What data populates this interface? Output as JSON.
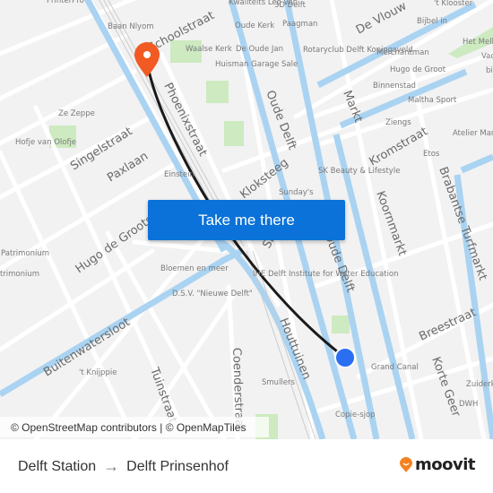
{
  "map": {
    "colors": {
      "background": "#f2f2f2",
      "road": "#ffffff",
      "water": "#aad3f2",
      "park": "#cdeac0",
      "route_line": "#1a1a1a",
      "origin_marker": "#2a6ff2",
      "destination_marker": "#f15a22",
      "cta": "#0a72d8"
    },
    "street_labels": [
      "Schoolstraat",
      "Phoenixstraat",
      "De Vlouw",
      "Oude Delft",
      "Markt",
      "Kromstraat",
      "Koornmarkt",
      "Brabantse Turfmarkt",
      "Singelstraat",
      "Paxlaan",
      "Hugo de Grootstraat",
      "Kloksteeg",
      "Buitenwatersloot",
      "Tuinstraat",
      "Coenderstraat",
      "Houttuinen",
      "Breestraat",
      "Korte Geer",
      "Oude Delft",
      "Sint"
    ],
    "poi_labels": [
      "PrinterPro",
      "Baan Nlyom",
      "Waalse Kerk",
      "De Oude Jan",
      "Huisman Garage Sale",
      "Kwaliteits Leo van",
      "3D Delft",
      "Oude Kerk",
      "Paagman",
      "Rotaryclub Delft Koningsveld",
      "'t Klooster",
      "Bijbel in",
      "Het Melk",
      "Vad",
      "bi",
      "Merchantman",
      "Hugo de Groot",
      "Binnenstad",
      "Maltha Sport",
      "Ziengs",
      "Atelier Mar",
      "Etos",
      "Ze Zeppe",
      "Hofje van Olofje",
      "Einstein",
      "SK Beauty & Lifestyle",
      "Sunday's",
      "Patrimonium",
      "Patrimonium",
      "Bloemen en meer",
      "D.S.V. \"Nieuwe Delft\"",
      "IHE Delft Institute for Water Education",
      "'t Knijppie",
      "Grand Canal",
      "Smullers",
      "Copie-sjop",
      "Zuiderk",
      "DWH"
    ],
    "origin_marker": "origin-dot",
    "destination_marker": "destination-pin"
  },
  "cta": {
    "label": "Take me there"
  },
  "attribution": "© OpenStreetMap contributors | © OpenMapTiles",
  "footer": {
    "origin": "Delft Station",
    "arrow": "→",
    "destination": "Delft Prinsenhof",
    "brand": "moovit"
  }
}
